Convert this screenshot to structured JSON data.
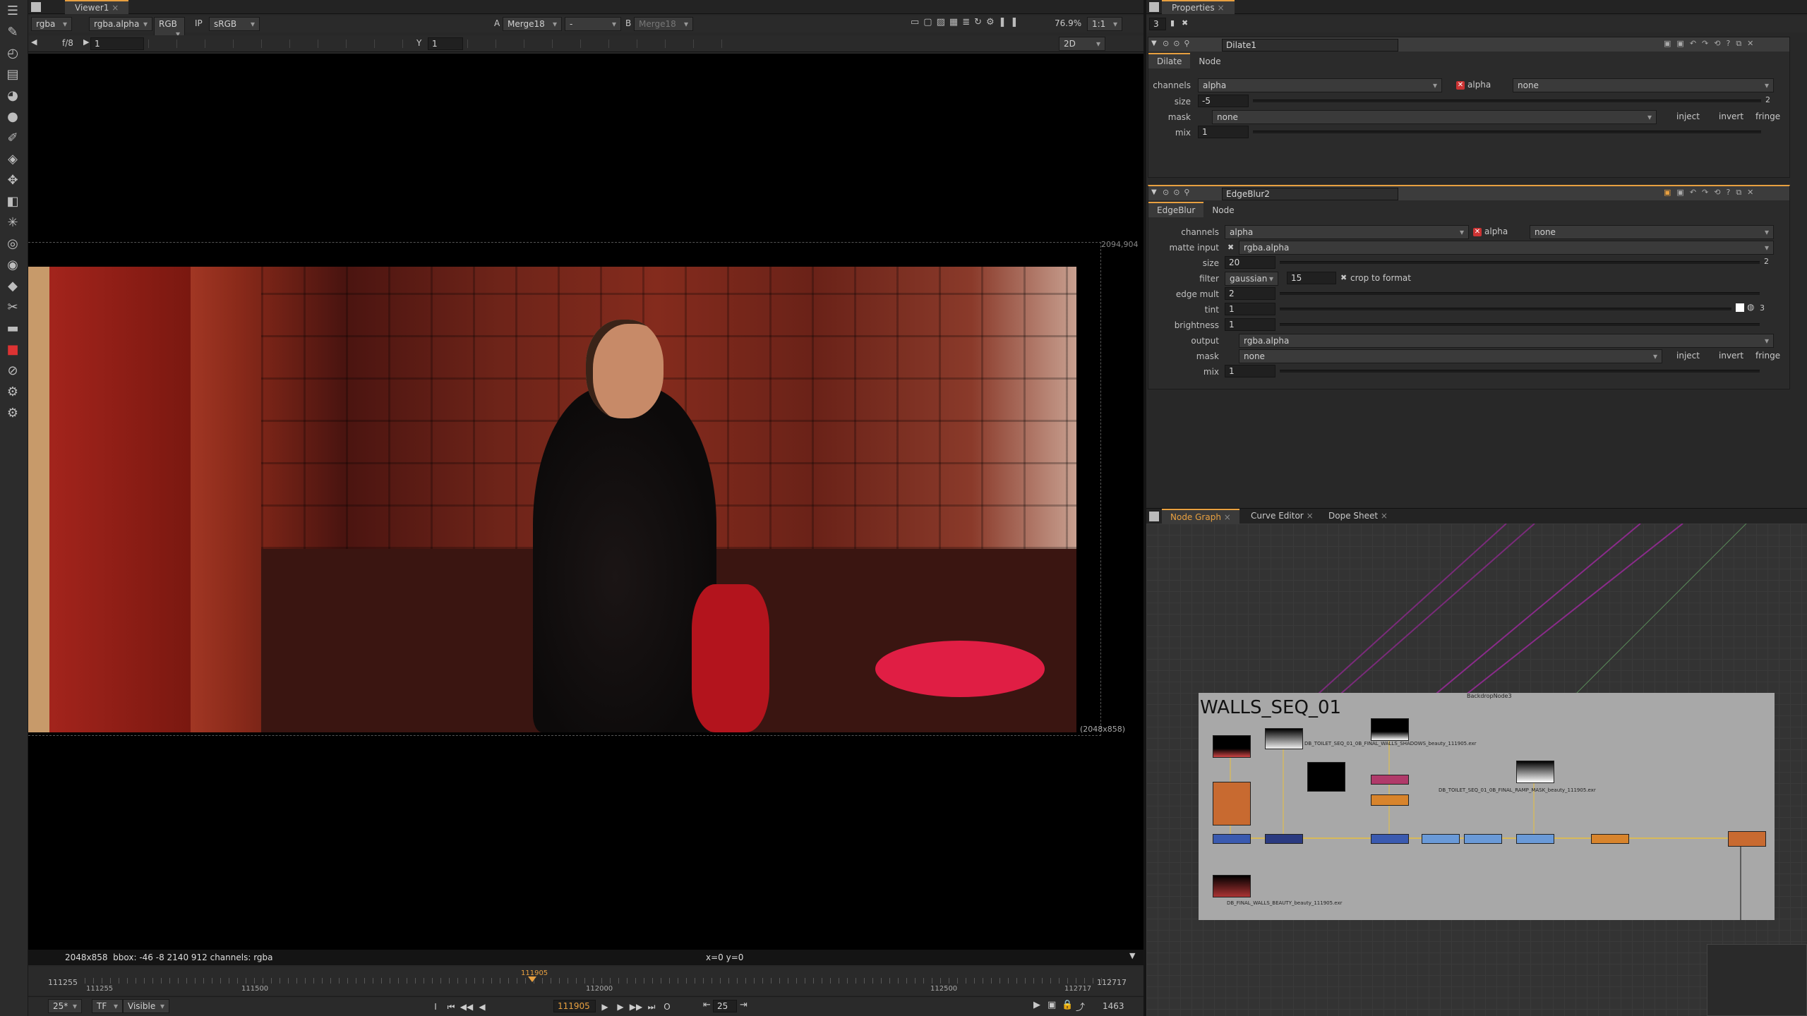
{
  "viewer": {
    "tab": "Viewer1",
    "channels": "rgba",
    "layer": "rgba.alpha",
    "display": "RGB",
    "ip": "IP",
    "lut": "sRGB",
    "a_label": "A",
    "a_input": "Merge18",
    "wipe": "-",
    "b_label": "B",
    "b_input": "Merge18",
    "zoom": "76.9%",
    "ratio": "1:1",
    "fstop": "f/8",
    "gain": "1",
    "y_label": "Y",
    "gamma": "1",
    "view_mode": "2D",
    "bbox_corner": "2094,904",
    "format_label": "(2048x858)",
    "info": "2048x858  bbox: -46 -8 2140 912 channels: rgba",
    "coords": "x=0 y=0"
  },
  "timeline": {
    "current_frame_marker": "111905",
    "start": "111255",
    "end": "112717",
    "labels": [
      "111255",
      "111500",
      "112000",
      "112500",
      "112717"
    ],
    "fps": "25*",
    "tf": "TF",
    "visible": "Visible",
    "current_frame": "111905",
    "increment": "25",
    "frame_count": "1463"
  },
  "properties": {
    "tab": "Properties",
    "max_panels": "3",
    "dilate": {
      "title": "Dilate1",
      "tabs": [
        "Dilate",
        "Node"
      ],
      "channels_label": "channels",
      "channels": "alpha",
      "alpha_check": "alpha",
      "alpha_other": "none",
      "size_label": "size",
      "size": "-5",
      "size_count": "2",
      "mask_label": "mask",
      "mask": "none",
      "inject": "inject",
      "invert": "invert",
      "fringe": "fringe",
      "mix_label": "mix",
      "mix": "1"
    },
    "edgeblur": {
      "title": "EdgeBlur2",
      "tabs": [
        "EdgeBlur",
        "Node"
      ],
      "channels_label": "channels",
      "channels": "alpha",
      "alpha_check": "alpha",
      "alpha_other": "none",
      "matte_label": "matte input",
      "matte": "rgba.alpha",
      "size_label": "size",
      "size": "20",
      "size_count": "2",
      "filter_label": "filter",
      "filter": "gaussian",
      "filter_quality": "15",
      "crop": "crop to format",
      "edge_mult_label": "edge mult",
      "edge_mult": "2",
      "tint_label": "tint",
      "tint": "1",
      "tint_count": "3",
      "brightness_label": "brightness",
      "brightness": "1",
      "output_label": "output",
      "output": "rgba.alpha",
      "mask_label": "mask",
      "mask": "none",
      "inject": "inject",
      "invert": "invert",
      "fringe": "fringe",
      "mix_label": "mix",
      "mix": "1"
    }
  },
  "nodegraph": {
    "tabs": [
      "Node Graph",
      "Curve Editor",
      "Dope Sheet"
    ],
    "backdrop_title": "WALLS_SEQ_01",
    "backdrop_node": "BackdropNode3",
    "read_labels": [
      "DB_TOILET_SEQ_01_0B_FINAL_WALLS_SHADOWS_beauty_111905.exr",
      "DB_TOILET_SEQ_01_0B_FINAL_RAMP_MASK_beauty_111905.exr",
      "DB_FINAL_WALLS_BEAUTY_beauty_111905.exr"
    ]
  },
  "colors": {
    "accent": "#e8a040",
    "backdrop": "#a8a8a8"
  }
}
